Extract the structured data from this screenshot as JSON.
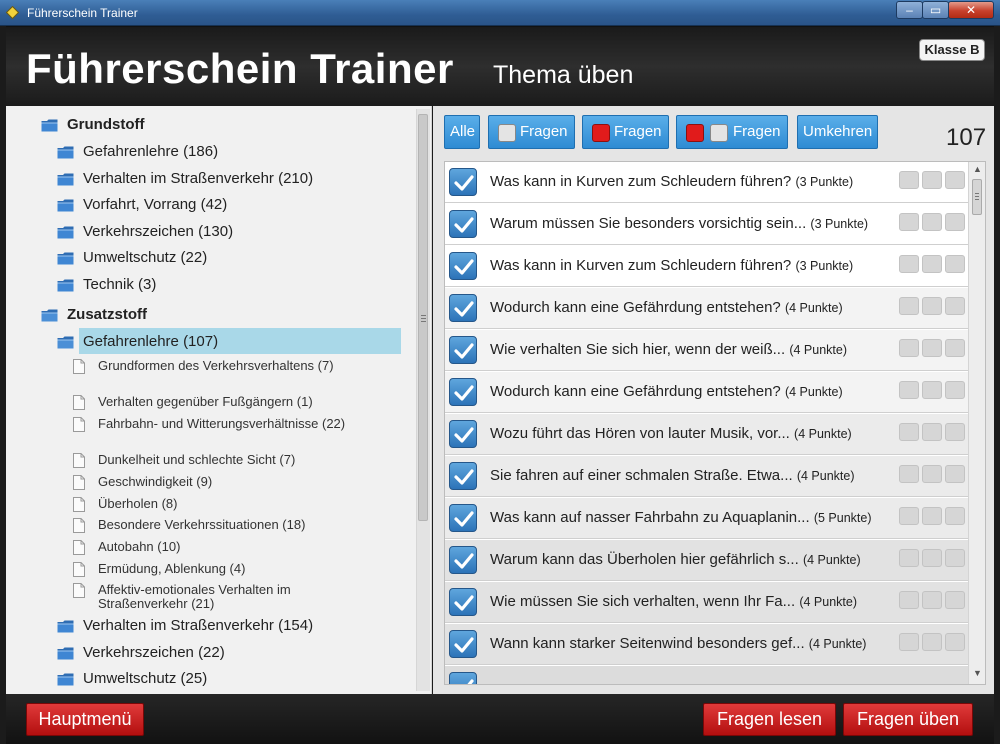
{
  "window": {
    "title": "Führerschein Trainer"
  },
  "header": {
    "app_title": "Führerschein Trainer",
    "page_title": "Thema üben",
    "class_badge": "Klasse B"
  },
  "tree": {
    "groups": [
      {
        "label": "Grundstoff",
        "items": [
          "Gefahrenlehre (186)",
          "Verhalten im Straßenverkehr (210)",
          "Vorfahrt, Vorrang (42)",
          "Verkehrszeichen (130)",
          "Umweltschutz (22)",
          "Technik (3)"
        ]
      },
      {
        "label": "Zusatzstoff",
        "selected_item": "Gefahrenlehre (107)",
        "subtopics": [
          "Grundformen des Verkehrsverhaltens (7)",
          "Verhalten gegenüber Fußgängern (1)",
          "Fahrbahn- und Witterungsverhältnisse (22)",
          "Dunkelheit und schlechte Sicht (7)",
          "Geschwindigkeit (9)",
          "Überholen (8)",
          "Besondere Verkehrssituationen (18)",
          "Autobahn (10)",
          "Ermüdung, Ablenkung (4)",
          "Affektiv-emotionales Verhalten im Straßenverkehr (21)"
        ],
        "items_after": [
          "Verhalten im Straßenverkehr (154)",
          "Verkehrszeichen (22)",
          "Umweltschutz (25)"
        ]
      }
    ]
  },
  "toolbar": {
    "all_label": "Alle",
    "questions_label": "Fragen",
    "invert_label": "Umkehren",
    "count": "107"
  },
  "questions": [
    {
      "text": "Was kann in Kurven zum Schleudern führen?",
      "points": "(3 Punkte)"
    },
    {
      "text": "Warum müssen Sie besonders vorsichtig sein...",
      "points": "(3 Punkte)"
    },
    {
      "text": "Was kann in Kurven zum Schleudern führen?",
      "points": "(3 Punkte)"
    },
    {
      "text": "Wodurch kann eine Gefährdung entstehen?",
      "points": "(4 Punkte)"
    },
    {
      "text": "Wie verhalten Sie sich hier, wenn der weiß...",
      "points": "(4 Punkte)"
    },
    {
      "text": "Wodurch kann eine Gefährdung entstehen?",
      "points": "(4 Punkte)"
    },
    {
      "text": "Wozu führt das Hören von lauter Musik, vor...",
      "points": "(4 Punkte)"
    },
    {
      "text": "Sie fahren auf einer schmalen Straße. Etwa...",
      "points": "(4 Punkte)"
    },
    {
      "text": "Was kann auf nasser Fahrbahn zu Aquaplanin...",
      "points": "(5 Punkte)"
    },
    {
      "text": "Warum kann das Überholen hier gefährlich s...",
      "points": "(4 Punkte)"
    },
    {
      "text": "Wie müssen Sie sich verhalten, wenn Ihr Fa...",
      "points": "(4 Punkte)"
    },
    {
      "text": "Wann kann starker Seitenwind besonders gef...",
      "points": "(4 Punkte)"
    }
  ],
  "footer": {
    "main_menu": "Hauptmenü",
    "read_questions": "Fragen lesen",
    "practice_questions": "Fragen üben"
  },
  "colors": {
    "accent_blue": "#2e8bd3",
    "footer_red": "#c81414",
    "selection": "#a9d8e8"
  }
}
